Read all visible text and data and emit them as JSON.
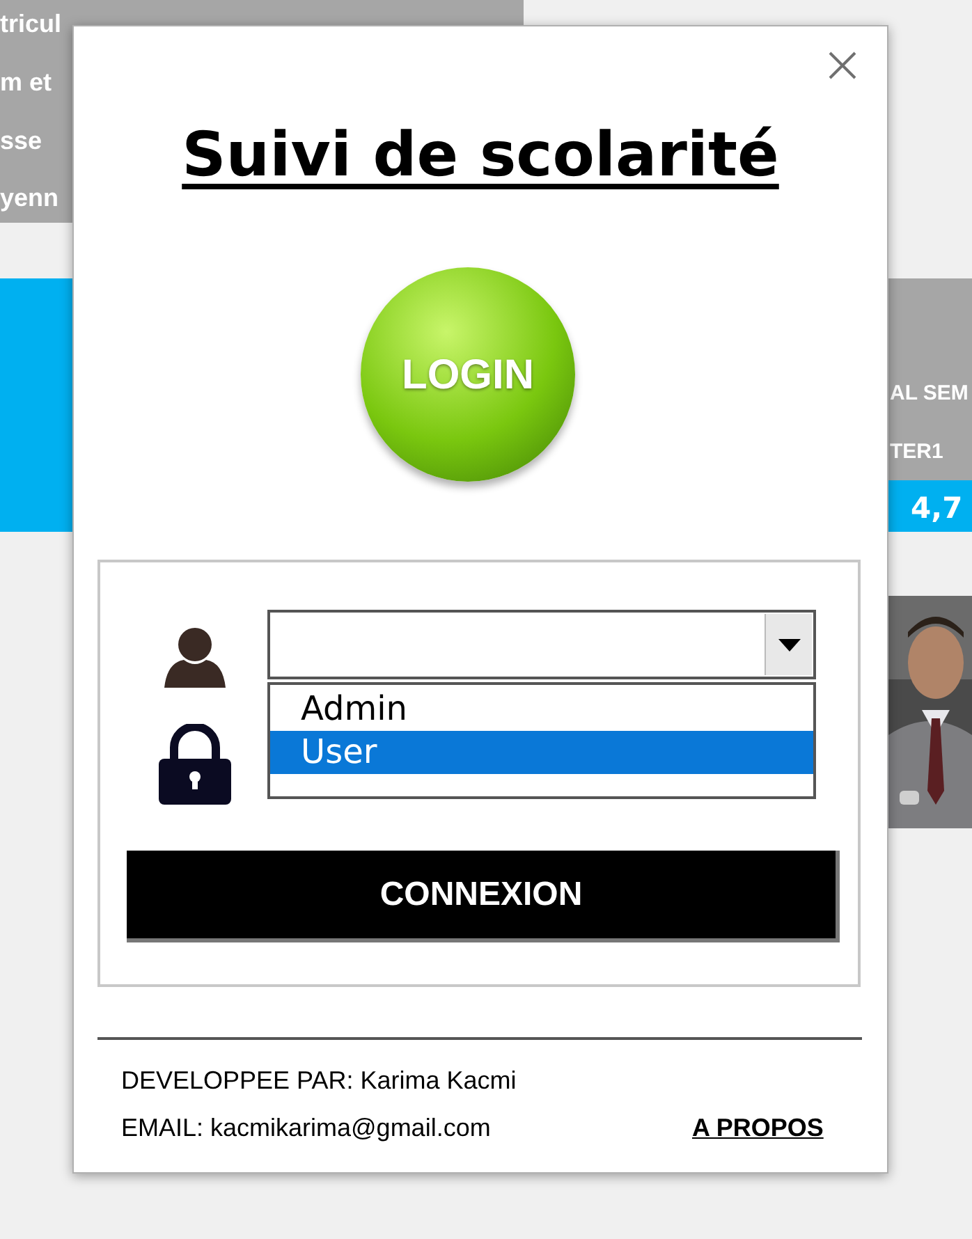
{
  "sheet": {
    "left_labels": [
      "tricul",
      "m et",
      "sse",
      "yenn"
    ],
    "right_labels": [
      "AL SEM",
      "TER1"
    ],
    "right_value": "4,7"
  },
  "dialog": {
    "title": "Suivi de scolarité",
    "logo_text": "LOGIN",
    "dropdown": {
      "options": [
        {
          "label": "Admin",
          "selected": false
        },
        {
          "label": "User",
          "selected": true
        }
      ]
    },
    "button": "CONNEXION",
    "developer": "DEVELOPPEE PAR: Karima Kacmi",
    "email": "EMAIL: kacmikarima@gmail.com",
    "about_link": "A PROPOS"
  }
}
